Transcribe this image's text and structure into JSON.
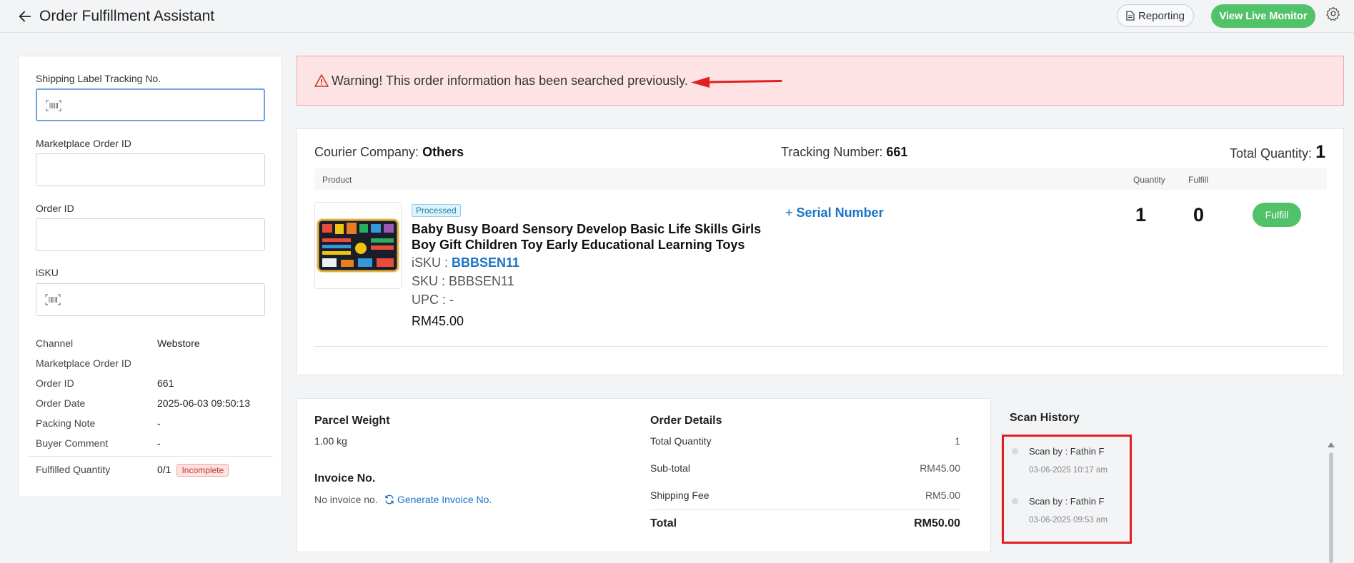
{
  "header": {
    "title": "Order Fulfillment Assistant",
    "reporting_label": "Reporting",
    "live_monitor_label": "View Live Monitor"
  },
  "search": {
    "shipping_label": "Shipping Label Tracking No.",
    "shipping_value": "",
    "marketplace_label": "Marketplace Order ID",
    "marketplace_value": "",
    "order_id_label": "Order ID",
    "order_id_value": "",
    "isku_label": "iSKU",
    "isku_value": ""
  },
  "order_info": {
    "rows": [
      {
        "label": "Channel",
        "value": "Webstore"
      },
      {
        "label": "Marketplace Order ID",
        "value": ""
      },
      {
        "label": "Order ID",
        "value": "661"
      },
      {
        "label": "Order Date",
        "value": "2025-06-03 09:50:13"
      },
      {
        "label": "Packing Note",
        "value": "-"
      },
      {
        "label": "Buyer Comment",
        "value": "-"
      }
    ],
    "fulfilled_label": "Fulfilled Quantity",
    "fulfilled_value": "0/1",
    "fulfilled_status": "Incomplete"
  },
  "warning": {
    "text": "Warning! This order information has been searched previously."
  },
  "order_summary": {
    "courier_label": "Courier Company:",
    "courier_value": "Others",
    "tracking_label": "Tracking Number:",
    "tracking_value": "661",
    "total_qty_label": "Total Quantity:",
    "total_qty_value": "1"
  },
  "product_table": {
    "headers": {
      "product": "Product",
      "quantity": "Quantity",
      "fulfill": "Fulfill"
    },
    "item": {
      "status": "Processed",
      "name": "Baby Busy Board Sensory Develop Basic Life Skills Girls Boy Gift Children Toy Early Educational Learning Toys",
      "isku_label": "iSKU :",
      "isku_value": "BBBSEN11",
      "sku": "SKU : BBBSEN11",
      "upc": "UPC : -",
      "price": "RM45.00",
      "serial_label": "Serial Number",
      "quantity": "1",
      "fulfill": "0",
      "fulfill_button": "Fulfill"
    }
  },
  "parcel": {
    "weight_title": "Parcel Weight",
    "weight_value": "1.00 kg",
    "invoice_title": "Invoice No.",
    "invoice_value": "No invoice no.",
    "generate_label": "Generate Invoice No."
  },
  "order_details": {
    "title": "Order Details",
    "total_qty_label": "Total Quantity",
    "total_qty_value": "1",
    "subtotal_label": "Sub-total",
    "subtotal_value": "RM45.00",
    "shipping_label": "Shipping Fee",
    "shipping_value": "RM5.00",
    "total_label": "Total",
    "total_value": "RM50.00"
  },
  "scan_history": {
    "title": "Scan History",
    "entries": [
      {
        "by": "Scan by : Fathin F",
        "time": "03-06-2025 10:17 am"
      },
      {
        "by": "Scan by : Fathin F",
        "time": "03-06-2025 09:53 am"
      }
    ]
  },
  "colors": {
    "accent_green": "#52c26a",
    "link_blue": "#1a73c8",
    "warning_bg": "#fde3e3",
    "highlight_red": "#e02020"
  }
}
